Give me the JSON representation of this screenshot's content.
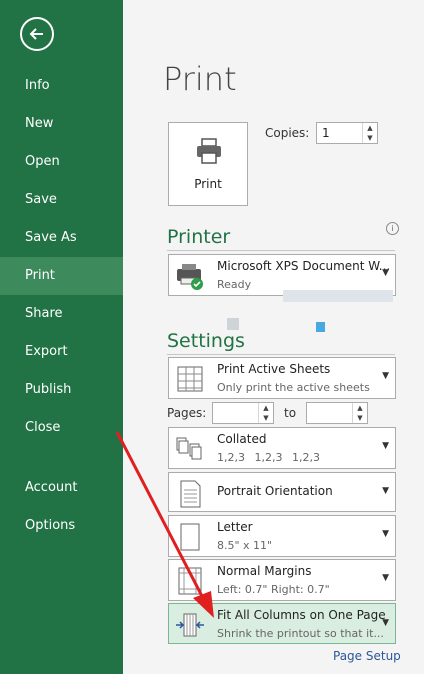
{
  "sidebar": {
    "items": [
      {
        "label": "Info"
      },
      {
        "label": "New"
      },
      {
        "label": "Open"
      },
      {
        "label": "Save"
      },
      {
        "label": "Save As"
      },
      {
        "label": "Print",
        "active": true
      },
      {
        "label": "Share"
      },
      {
        "label": "Export"
      },
      {
        "label": "Publish"
      },
      {
        "label": "Close"
      },
      {
        "label": "Account"
      },
      {
        "label": "Options"
      }
    ]
  },
  "main": {
    "title": "Print",
    "print_button_label": "Print",
    "copies_label": "Copies:",
    "copies_value": "1",
    "printer_heading": "Printer",
    "printer": {
      "name": "Microsoft XPS Document W...",
      "status": "Ready"
    },
    "settings_heading": "Settings",
    "pages_label": "Pages:",
    "to_label": "to",
    "settings": [
      {
        "title": "Print Active Sheets",
        "sub": "Only print the active sheets",
        "icon": "sheets-icon"
      },
      {
        "title": "Collated",
        "sub": "1,2,3    1,2,3    1,2,3",
        "icon": "collate-icon"
      },
      {
        "title": "Portrait Orientation",
        "sub": "",
        "icon": "portrait-icon"
      },
      {
        "title": "Letter",
        "sub": "8.5\" x 11\"",
        "icon": "paper-icon"
      },
      {
        "title": "Normal Margins",
        "sub": "Left:  0.7\"    Right:  0.7\"",
        "icon": "margins-icon"
      },
      {
        "title": "Fit All Columns on One Page",
        "sub": "Shrink the printout so that it...",
        "icon": "fit-columns-icon"
      }
    ],
    "page_setup_link": "Page Setup"
  },
  "colors": {
    "brand": "#217346",
    "annotation_arrow": "#e02020"
  }
}
